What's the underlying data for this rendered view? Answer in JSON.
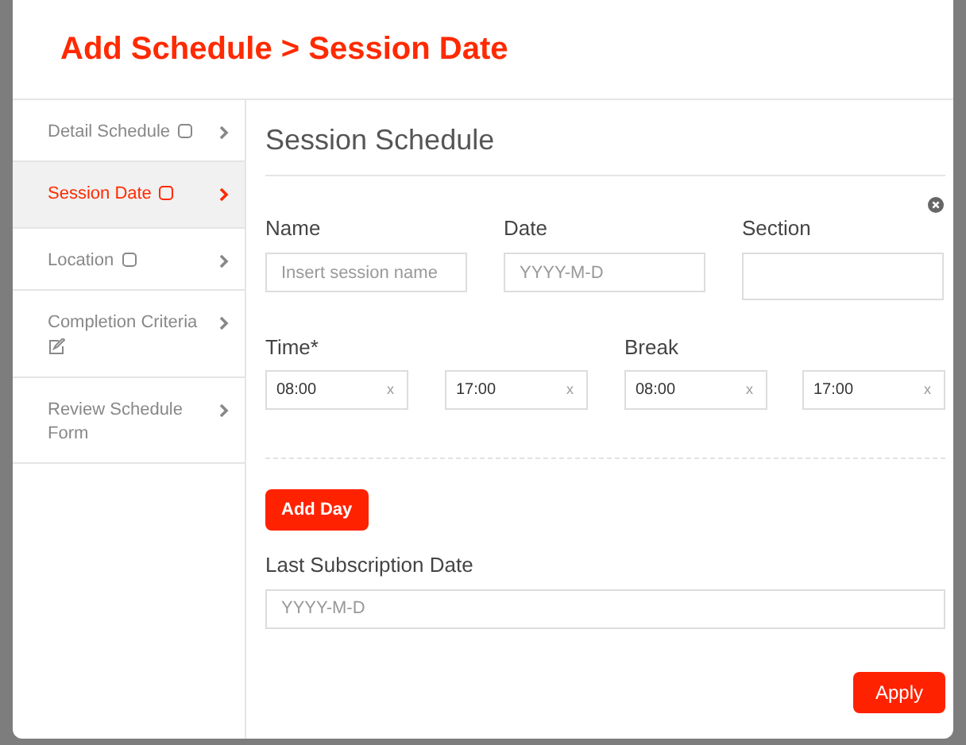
{
  "window": {
    "title": "Add Schedule > Session Date"
  },
  "steps": [
    {
      "label": "Detail Schedule",
      "kind": "square",
      "selected": false
    },
    {
      "label": "Session Date",
      "kind": "square",
      "selected": true
    },
    {
      "label": "Location",
      "kind": "square",
      "selected": false
    },
    {
      "label": "Completion Criteria",
      "kind": "edit",
      "selected": false
    },
    {
      "label": "Review Schedule Form",
      "selected": false
    }
  ],
  "section_title": "Session Schedule",
  "fields": [
    {
      "label": "Name",
      "placeholder": "Insert session name"
    },
    {
      "label": "Date",
      "placeholder": "YYYY-M-D"
    },
    {
      "label": "Section"
    }
  ],
  "time": {
    "label": "Time*",
    "inputs": [
      {
        "value": "08:00",
        "clear": "x"
      },
      {
        "value": "17:00",
        "clear": "x"
      }
    ]
  },
  "break": {
    "label": "Break",
    "inputs": [
      {
        "value": "08:00",
        "clear": "x"
      },
      {
        "value": "17:00",
        "clear": "x"
      }
    ]
  },
  "add_day_button": "Add Day",
  "last_subscription": {
    "label": "Last Subscription Date",
    "placeholder": "YYYY-M-D"
  },
  "apply_button": "Apply"
}
